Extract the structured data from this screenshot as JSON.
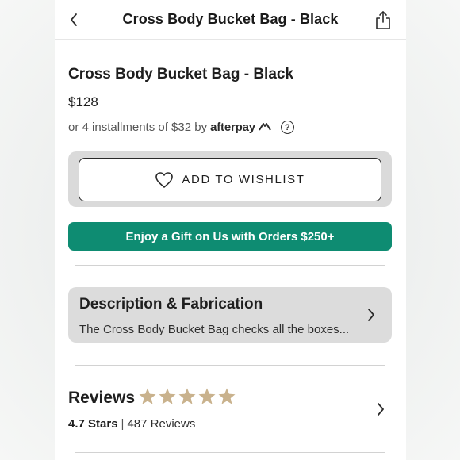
{
  "nav": {
    "title": "Cross Body Bucket Bag - Black",
    "back_icon": "chevron-left-icon",
    "share_icon": "share-icon"
  },
  "product": {
    "name": "Cross Body Bucket Bag - Black",
    "price": "$128",
    "installments_prefix": "or 4 installments of $32 by",
    "afterpay_logo": "afterpay",
    "help_glyph": "?"
  },
  "wishlist": {
    "label": "ADD TO WISHLIST",
    "icon": "heart-icon"
  },
  "promo": {
    "label": "Enjoy a Gift on Us with Orders $250+",
    "color": "#0e8c72"
  },
  "description": {
    "heading": "Description & Fabrication",
    "summary": "The Cross Body Bucket Bag checks all the boxes..."
  },
  "reviews": {
    "heading": "Reviews",
    "rating_text": "4.7 Stars",
    "separator": "|",
    "count_text": "487 Reviews",
    "star_count": 5,
    "star_color": "#c9b28d"
  }
}
